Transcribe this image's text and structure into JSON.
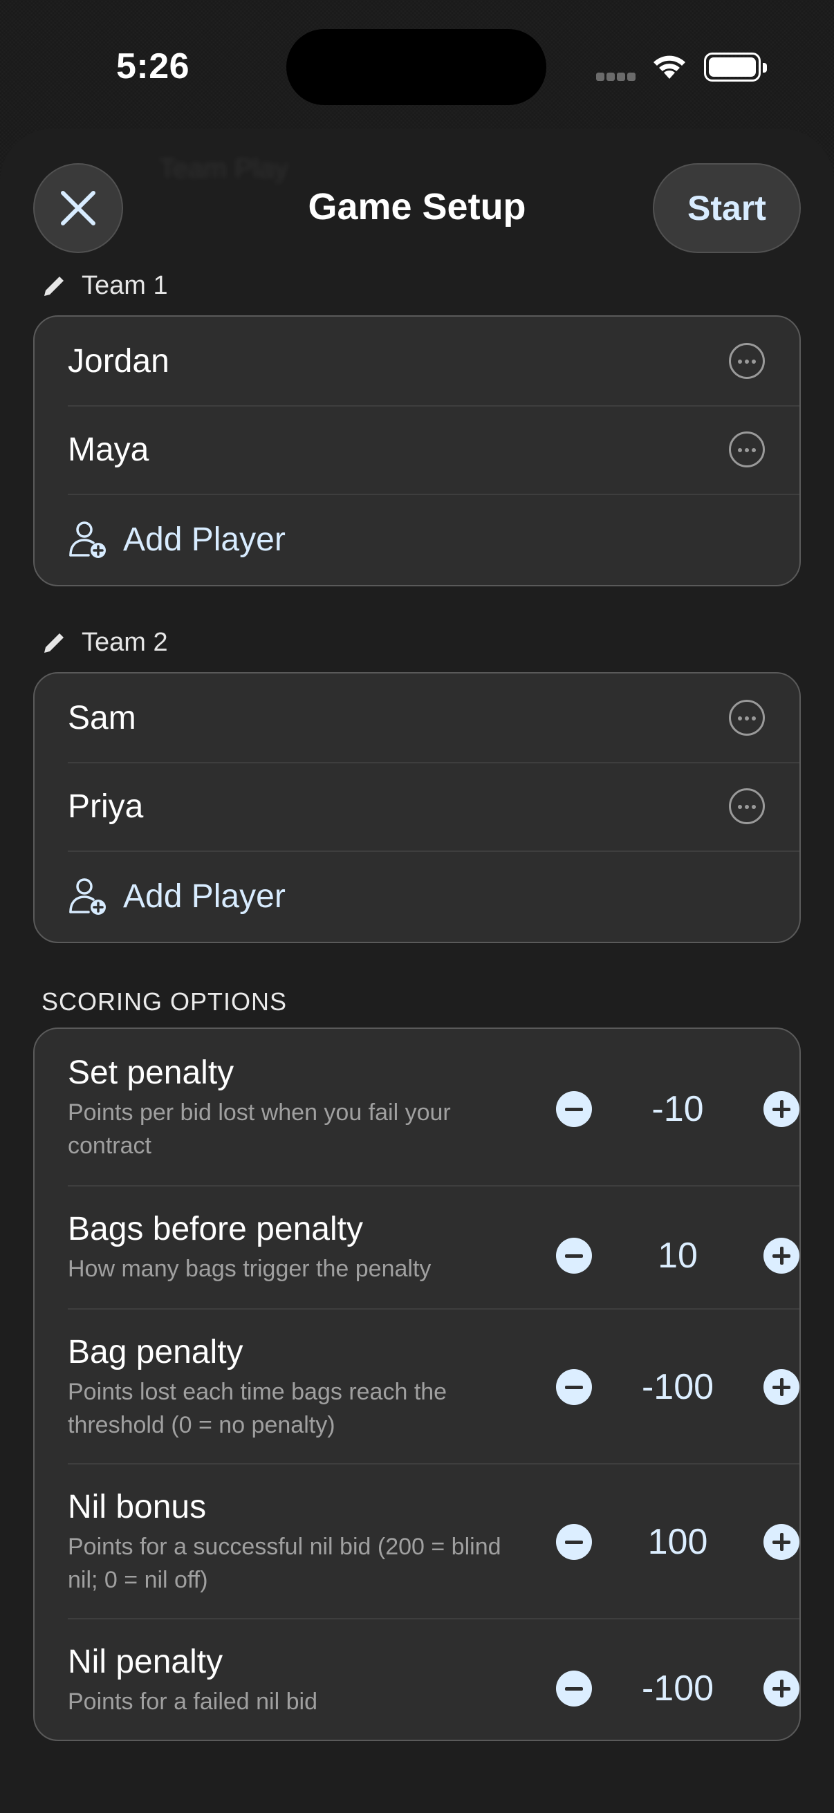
{
  "status_bar": {
    "time": "5:26"
  },
  "header": {
    "title": "Game Setup",
    "start_label": "Start",
    "background_ghost_text": "Team Play"
  },
  "teams": [
    {
      "label": "Team 1",
      "players": [
        "Jordan",
        "Maya"
      ],
      "add_label": "Add Player"
    },
    {
      "label": "Team 2",
      "players": [
        "Sam",
        "Priya"
      ],
      "add_label": "Add Player"
    }
  ],
  "scoring": {
    "header": "SCORING OPTIONS",
    "options": [
      {
        "title": "Set penalty",
        "subtitle": "Points per bid lost when you fail your contract",
        "value": "-10"
      },
      {
        "title": "Bags before penalty",
        "subtitle": "How many bags trigger the penalty",
        "value": "10"
      },
      {
        "title": "Bag penalty",
        "subtitle": "Points lost each time bags reach the threshold (0 = no penalty)",
        "value": "-100"
      },
      {
        "title": "Nil bonus",
        "subtitle": "Points for a successful nil bid (200 = blind nil; 0 = nil off)",
        "value": "100"
      },
      {
        "title": "Nil penalty",
        "subtitle": "Points for a failed nil bid",
        "value": "-100"
      }
    ]
  },
  "colors": {
    "accent": "#d8ecff",
    "card": "#2e2e2e",
    "card_border": "#5a5a5a",
    "subtitle": "#a0a0a0"
  }
}
